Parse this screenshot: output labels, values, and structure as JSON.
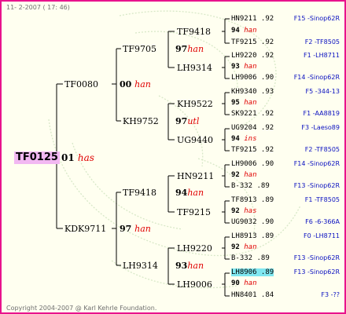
{
  "header": {
    "text": "11- 2-2007 ( 17: 46)"
  },
  "footer": {
    "text": "Copyright 2004-2007 @ Karl Kehrle Foundation."
  },
  "root": {
    "name": "TF0125",
    "year": "01",
    "queen": "has"
  },
  "l1": [
    {
      "name": "TF0080",
      "year": "00",
      "queen": "han"
    },
    {
      "name": "KDK9711",
      "year": "97",
      "queen": "han"
    }
  ],
  "l2": [
    {
      "name": "TF9705",
      "year": "97",
      "queen": "han"
    },
    {
      "name": "KH9752",
      "year": "97",
      "queen": "utl"
    },
    {
      "name": "TF9418",
      "year": "94",
      "queen": "han"
    },
    {
      "name": "LH9314",
      "year": "93",
      "queen": "han"
    }
  ],
  "l3": [
    {
      "name": "TF9418"
    },
    {
      "name": "LH9314"
    },
    {
      "name": "KH9522"
    },
    {
      "name": "UG9440"
    },
    {
      "name": "HN9211"
    },
    {
      "name": "TF9215"
    },
    {
      "name": "LH9220"
    },
    {
      "name": "LH9006"
    }
  ],
  "l4": [
    {
      "sire": "HN9211 .92",
      "year": "94",
      "queen": "han",
      "dam": "TF9215 .92",
      "sire_origin": "F15 -Sinop62R",
      "dam_origin": "F2 -TF8505"
    },
    {
      "sire": "LH9220 .92",
      "year": "93",
      "queen": "han",
      "dam": "LH9006 .90",
      "sire_origin": "F1 -LH8711",
      "dam_origin": "F14 -Sinop62R"
    },
    {
      "sire": "KH9340 .93",
      "year": "95",
      "queen": "han",
      "dam": "SK9221 .92",
      "sire_origin": "F5 -344-13",
      "dam_origin": "F1 -AA8819"
    },
    {
      "sire": "UG9204 .92",
      "year": "94",
      "queen": "ins",
      "dam": "TF9215 .92",
      "sire_origin": "F3 -Laeso89",
      "dam_origin": "F2 -TF8505"
    },
    {
      "sire": "LH9006 .90",
      "year": "92",
      "queen": "han",
      "dam": "B-332 .89",
      "sire_origin": "F14 -Sinop62R",
      "dam_origin": "F13 -Sinop62R"
    },
    {
      "sire": "TF8913 .89",
      "year": "92",
      "queen": "has",
      "dam": "UG9032 .90",
      "sire_origin": "F1 -TF8505",
      "dam_origin": "F6 -6-366A"
    },
    {
      "sire": "LH8913 .89",
      "year": "92",
      "queen": "han",
      "dam": "B-332 .89",
      "sire_origin": "F0 -LH8711",
      "dam_origin": "F13 -Sinop62R"
    },
    {
      "sire": "LH8906 .89",
      "year": "90",
      "queen": "han",
      "dam": "HN8401 .84",
      "sire_origin": "F13 -Sinop62R",
      "dam_origin": "F3 -??"
    }
  ],
  "colors": {
    "border": "#e8138c",
    "background": "#fffff0",
    "root_highlight": "#f2b8f2",
    "cell_highlight": "#7fe7f0",
    "queen_text": "#e00000",
    "origin_text": "#0a10c0"
  }
}
